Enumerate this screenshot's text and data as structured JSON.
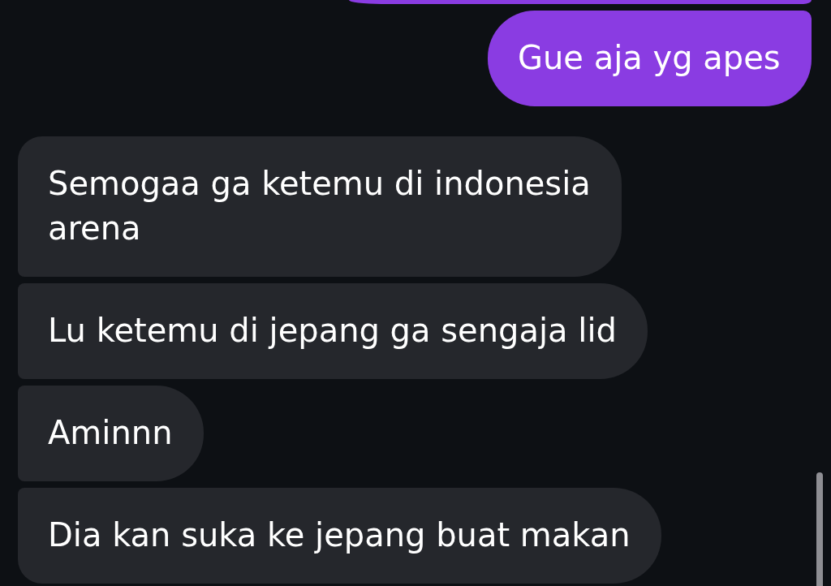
{
  "messages": [
    {
      "kind": "sent",
      "clipped": true
    },
    {
      "kind": "sent",
      "clipped": false,
      "text": "Gue aja yg apes"
    },
    {
      "kind": "received",
      "clipped": false,
      "text": "Semogaa ga ketemu di indonesia arena"
    },
    {
      "kind": "received",
      "clipped": false,
      "text": "Lu ketemu di jepang ga sengaja lid"
    },
    {
      "kind": "received",
      "clipped": false,
      "text": "Aminnn"
    },
    {
      "kind": "received",
      "clipped": false,
      "text": "Dia kan suka ke jepang buat makan"
    }
  ]
}
